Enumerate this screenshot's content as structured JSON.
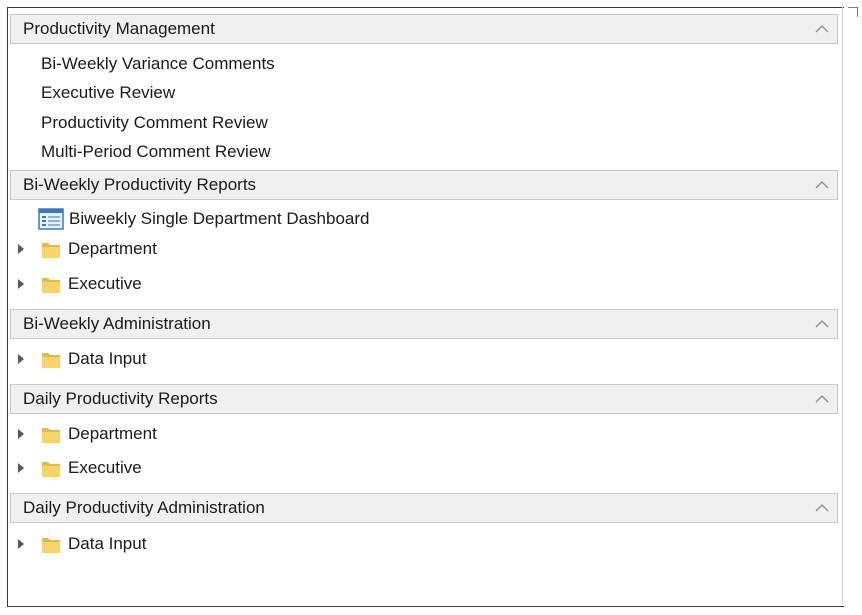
{
  "sections": [
    {
      "title": "Productivity Management",
      "links": [
        "Bi-Weekly Variance Comments",
        "Executive Review",
        "Productivity Comment Review",
        "Multi-Period Comment Review"
      ]
    },
    {
      "title": "Bi-Weekly Productivity Reports",
      "dashboard": "Biweekly Single Department Dashboard",
      "folders": [
        "Department",
        "Executive"
      ]
    },
    {
      "title": "Bi-Weekly Administration",
      "folders": [
        "Data Input"
      ]
    },
    {
      "title": "Daily Productivity Reports",
      "folders": [
        "Department",
        "Executive"
      ]
    },
    {
      "title": "Daily Productivity Administration",
      "folders": [
        "Data Input"
      ]
    }
  ],
  "icons": {
    "chevron": "chevron-up-icon",
    "folder": "folder-icon",
    "dashboard": "dashboard-icon",
    "expander": "expand-arrow-icon"
  },
  "colors": {
    "header_bg": "#f0f0f0",
    "folder": "#f2c94c",
    "text": "#1a1a1a"
  }
}
